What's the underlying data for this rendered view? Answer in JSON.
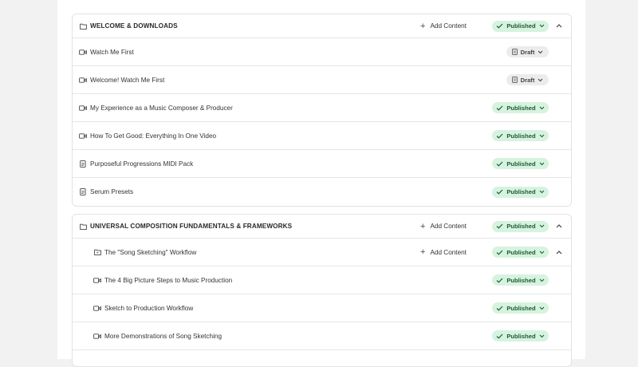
{
  "sections": [
    {
      "title": "WELCOME & DOWNLOADS",
      "add_label": "Add Content",
      "status": "Published",
      "items": [
        {
          "icon": "video-icon",
          "label": "Watch Me First",
          "status": "Draft"
        },
        {
          "icon": "video-icon",
          "label": "Welcome! Watch Me First",
          "status": "Draft"
        },
        {
          "icon": "video-icon",
          "label": "My Experience as a Music Composer & Producer",
          "status": "Published"
        },
        {
          "icon": "video-icon",
          "label": "How To Get Good: Everything In One Video",
          "status": "Published"
        },
        {
          "icon": "document-icon",
          "label": "Purposeful Progressions MIDI Pack",
          "status": "Published"
        },
        {
          "icon": "document-icon",
          "label": "Serum Presets",
          "status": "Published"
        }
      ]
    },
    {
      "title": "UNIVERSAL COMPOSITION FUNDAMENTALS & FRAMEWORKS",
      "add_label": "Add Content",
      "status": "Published",
      "subsection": {
        "title": "The \"Song Sketching\" Workflow",
        "add_label": "Add Content",
        "status": "Published"
      },
      "items": [
        {
          "icon": "video-icon",
          "label": "The 4 Big Picture Steps to Music Production",
          "status": "Published"
        },
        {
          "icon": "video-icon",
          "label": "Sketch to Production Workflow",
          "status": "Published"
        },
        {
          "icon": "video-icon",
          "label": "More Demonstrations of Song Sketching",
          "status": "Published"
        }
      ]
    }
  ]
}
